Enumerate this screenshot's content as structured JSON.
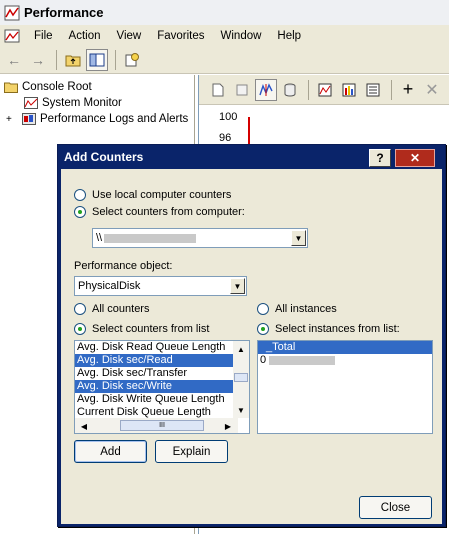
{
  "window": {
    "title": "Performance"
  },
  "menu": [
    "File",
    "Action",
    "View",
    "Favorites",
    "Window",
    "Help"
  ],
  "tree": {
    "root": "Console Root",
    "items": [
      "System Monitor",
      "Performance Logs and Alerts"
    ],
    "expander": "+"
  },
  "graph": {
    "ticks": [
      "100",
      "96"
    ]
  },
  "dialog": {
    "title": "Add Counters",
    "help_label": "?",
    "close_label": "✕",
    "use_local": "Use local computer counters",
    "select_from_computer": "Select counters from computer:",
    "computer_prefix": "\\\\",
    "perf_object_label": "Performance object:",
    "perf_object_value": "PhysicalDisk",
    "all_counters": "All counters",
    "select_counters": "Select counters from list",
    "all_instances": "All instances",
    "select_instances": "Select instances from list:",
    "counters": [
      {
        "label": "Avg. Disk Read Queue Length",
        "selected": false
      },
      {
        "label": "Avg. Disk sec/Read",
        "selected": true
      },
      {
        "label": "Avg. Disk sec/Transfer",
        "selected": false
      },
      {
        "label": "Avg. Disk sec/Write",
        "selected": true
      },
      {
        "label": "Avg. Disk Write Queue Length",
        "selected": false
      },
      {
        "label": "Current Disk Queue Length",
        "selected": false
      }
    ],
    "instances": [
      {
        "label": "_Total",
        "selected": true
      },
      {
        "label": "0",
        "selected": false
      }
    ],
    "add_label": "Add",
    "explain_label": "Explain",
    "close_button_label": "Close"
  },
  "colors": {
    "dialog_title": "#0a246a",
    "selection": "#316ac5",
    "graph_line": "#d40000"
  }
}
